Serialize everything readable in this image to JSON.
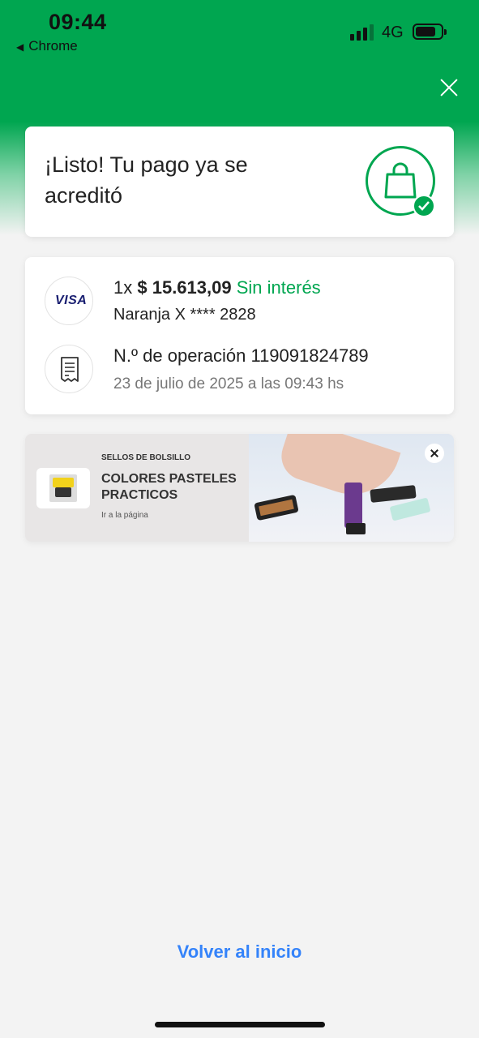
{
  "status_bar": {
    "time": "09:44",
    "back_app": "Chrome",
    "network": "4G"
  },
  "header": {
    "close_icon": "close-icon"
  },
  "success": {
    "title": "¡Listo! Tu pago ya se acreditó",
    "icon": "shopping-bag-check-icon"
  },
  "payment": {
    "installments": "1x",
    "amount": "$ 15.613,09",
    "interest_label": "Sin interés",
    "card_brand": "VISA",
    "card_info": "Naranja X **** 2828",
    "operation_label": "N.º de operación 119091824789",
    "date": "23 de julio de 2025 a las 09:43 hs",
    "receipt_icon": "receipt-icon"
  },
  "ad": {
    "eyebrow": "SELLOS DE BOLSILLO",
    "title": "COLORES PASTELES PRACTICOS",
    "link": "Ir a la página"
  },
  "footer": {
    "back_home": "Volver al inicio"
  },
  "colors": {
    "brand_green": "#00a650",
    "link_blue": "#3483fa",
    "background": "#f3f3f3"
  }
}
